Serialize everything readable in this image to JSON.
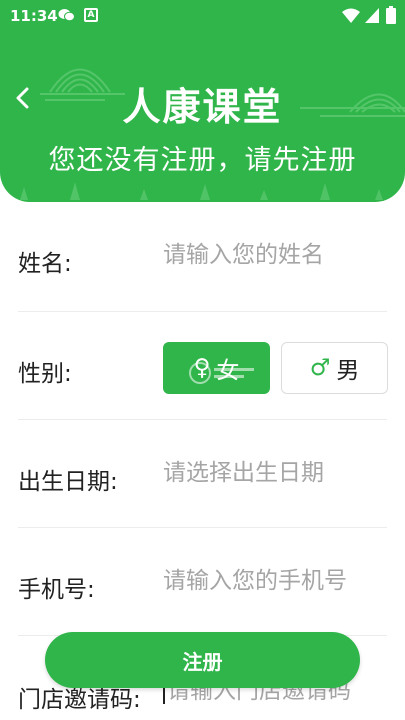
{
  "status_bar": {
    "time": "11:34",
    "a_icon_text": "A"
  },
  "header": {
    "title": "人康课堂",
    "subtitle": "您还没有注册，请先注册"
  },
  "form": {
    "name": {
      "label": "姓名:",
      "placeholder": "请输入您的姓名"
    },
    "gender": {
      "label": "性别:",
      "female_label": "女",
      "male_label": "男",
      "female_symbol": "♀",
      "male_symbol": "♂",
      "selected": "女"
    },
    "birthdate": {
      "label": "出生日期:",
      "placeholder": "请选择出生日期"
    },
    "phone": {
      "label": "手机号:",
      "placeholder": "请输入您的手机号"
    },
    "invite_code": {
      "label": "门店邀请码:",
      "placeholder": "请输入门店邀请码"
    }
  },
  "register_button_label": "注册",
  "colors": {
    "brand_green": "#2fb54a",
    "text_dark": "#222222",
    "placeholder_gray": "#a5a5a5"
  }
}
